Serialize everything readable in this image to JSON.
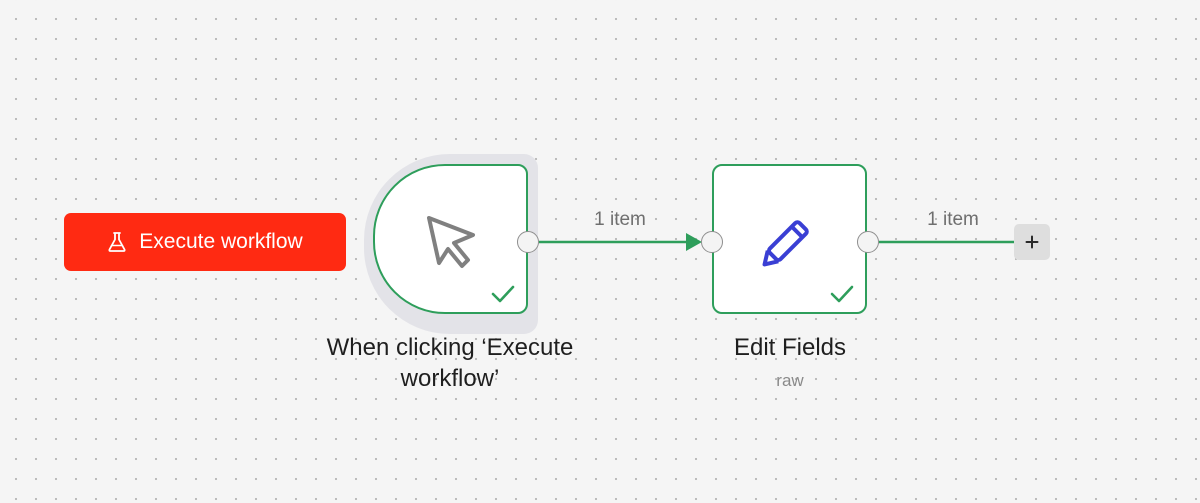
{
  "toolbar": {
    "execute_label": "Execute workflow",
    "execute_icon": "flask-icon",
    "accent_color": "#ff2a12"
  },
  "nodes": [
    {
      "title": "When clicking ‘Execute workflow’",
      "icon": "cursor-click-icon",
      "status": "success"
    },
    {
      "title": "Edit Fields",
      "subtitle": "raw",
      "icon": "pencil-icon",
      "status": "success"
    }
  ],
  "connections": [
    {
      "label": "1 item"
    },
    {
      "label": "1 item"
    }
  ],
  "colors": {
    "success": "#2e9e5b",
    "edit_icon": "#3a3fd4",
    "trigger_icon": "#808080"
  }
}
